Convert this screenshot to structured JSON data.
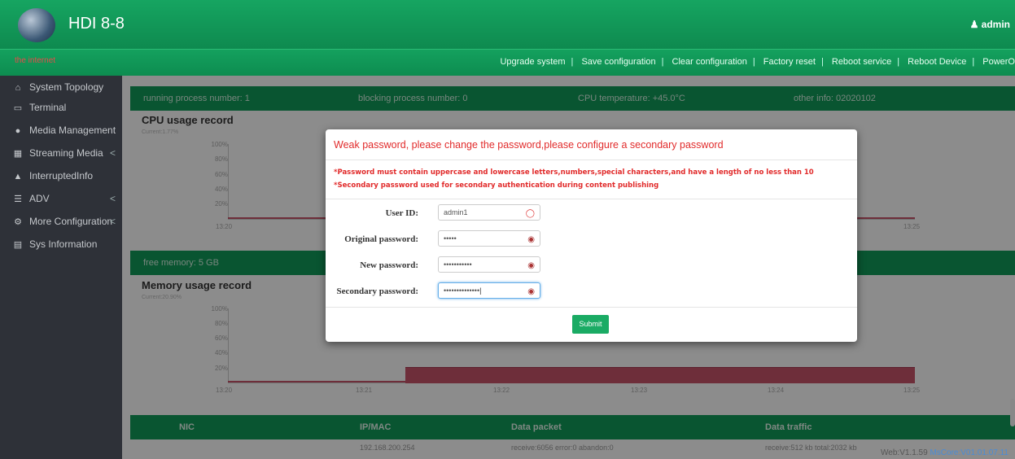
{
  "header": {
    "brand": "HDI 8-8",
    "user": "admin"
  },
  "toolbar": {
    "connection": "the internet",
    "menu": [
      "Upgrade system",
      "Save configuration",
      "Clear configuration",
      "Factory reset",
      "Reboot service",
      "Reboot Device",
      "PowerO"
    ]
  },
  "sidebar": {
    "items": [
      {
        "label": "System Topology",
        "icon": "home-icon"
      },
      {
        "label": "Terminal",
        "icon": "monitor-icon"
      },
      {
        "label": "Media Management",
        "icon": "record-icon"
      },
      {
        "label": "Streaming Media",
        "icon": "film-icon"
      },
      {
        "label": "InterruptedInfo",
        "icon": "bell-icon"
      },
      {
        "label": "ADV",
        "icon": "list-icon"
      },
      {
        "label": "More Configuration",
        "icon": "gears-icon"
      },
      {
        "label": "Sys Information",
        "icon": "table-icon"
      }
    ],
    "chevron": "<"
  },
  "status": {
    "running": "running process number: 1",
    "blocking": "blocking process number: 0",
    "temp": "CPU temperature: +45.0°C",
    "other": "other info: 02020102"
  },
  "cpu": {
    "title": "CPU usage record",
    "current": "Current:1.77%",
    "yticks": [
      "100%",
      "80%",
      "60%",
      "40%",
      "20%"
    ],
    "xticks": [
      "13:20",
      "13:25"
    ]
  },
  "memory": {
    "free": "free memory: 5 GB",
    "title": "Memory usage record",
    "current": "Current:20.90%",
    "yticks": [
      "100%",
      "80%",
      "60%",
      "40%",
      "20%"
    ],
    "xticks": [
      "13:20",
      "13:21",
      "13:22",
      "13:23",
      "13:24",
      "13:25"
    ]
  },
  "nic_table": {
    "headers": [
      "NIC",
      "IP/MAC",
      "Data packet",
      "Data traffic"
    ],
    "row": [
      "192.168.200.254",
      "receive:6056 error:0 abandon:0",
      "receive:512 kb  total:2032 kb"
    ]
  },
  "modal": {
    "title": "Weak password, please change the password,please configure a secondary password",
    "rule1": "*Password must contain uppercase and lowercase letters,numbers,special characters,and have a length of no less than 10",
    "rule2": "*Secondary password used for secondary authentication during content publishing",
    "fields": [
      {
        "label": "User ID:",
        "value": "admin1"
      },
      {
        "label": "Original password:",
        "value": "•••••"
      },
      {
        "label": "New password:",
        "value": "•••••••••••"
      },
      {
        "label": "Secondary password:",
        "value": "••••••••••••••"
      }
    ],
    "submit": "Submit"
  },
  "footer": {
    "version": "Web:V1.1.59",
    "core": "MsCore:V01.01.07.11"
  }
}
